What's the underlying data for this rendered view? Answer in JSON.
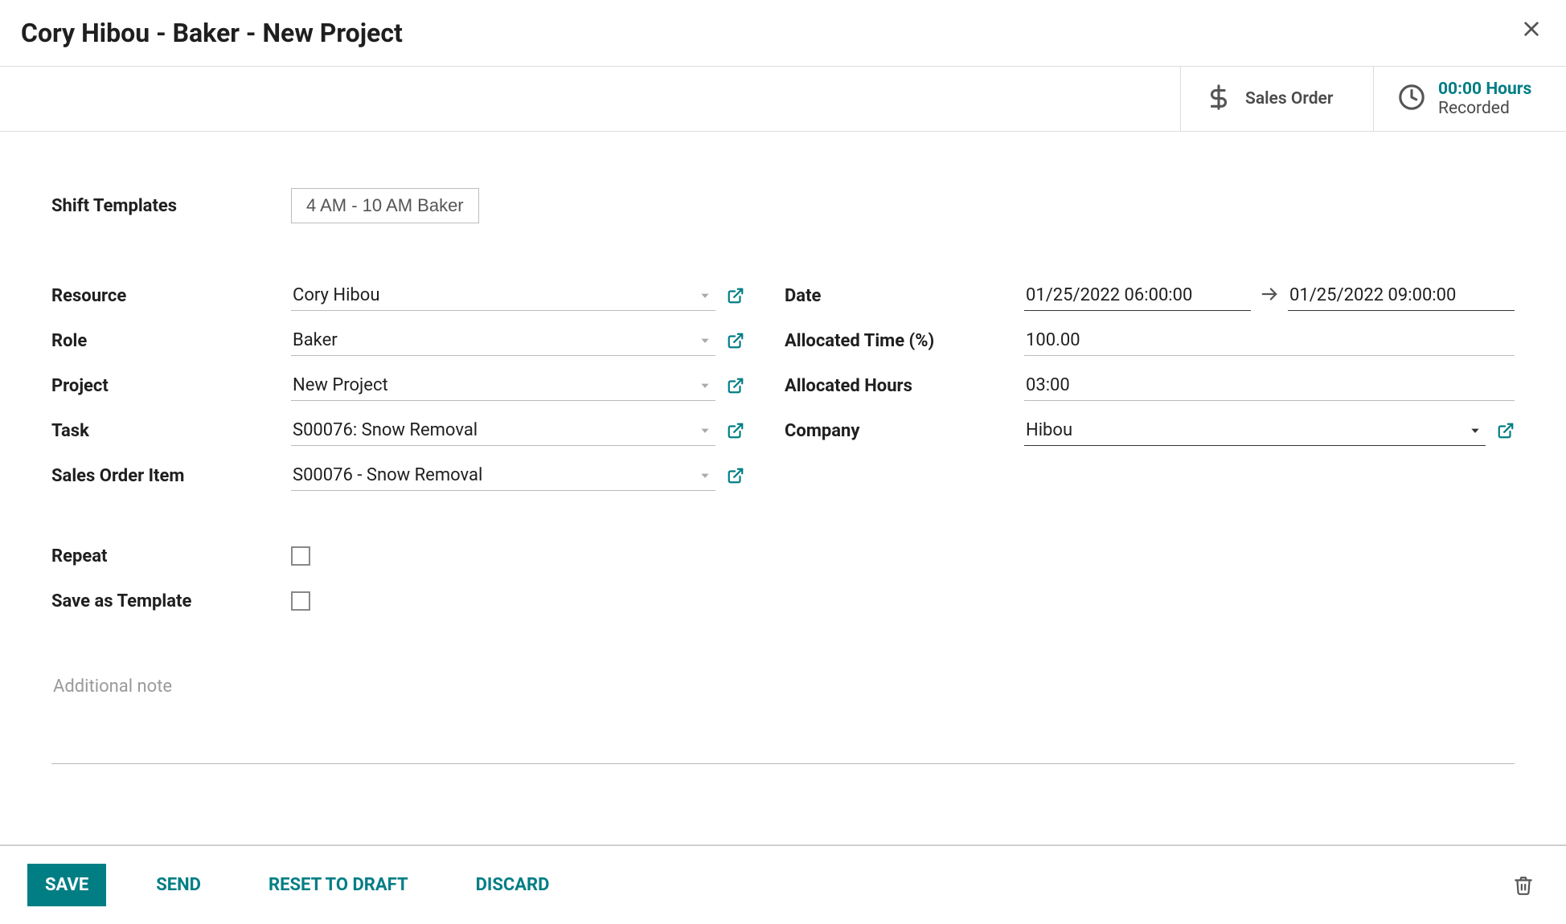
{
  "header": {
    "title": "Cory Hibou - Baker - New Project"
  },
  "stats": {
    "sales_order_label": "Sales Order",
    "hours_top": "00:00 Hours",
    "hours_bot": "Recorded"
  },
  "templates": {
    "label": "Shift Templates",
    "chip": "4 AM - 10 AM Baker"
  },
  "fields": {
    "resource_label": "Resource",
    "resource_value": "Cory Hibou",
    "role_label": "Role",
    "role_value": "Baker",
    "project_label": "Project",
    "project_value": "New Project",
    "task_label": "Task",
    "task_value": "S00076: Snow Removal",
    "soi_label": "Sales Order Item",
    "soi_value": "S00076 - Snow Removal",
    "repeat_label": "Repeat",
    "save_template_label": "Save as Template",
    "date_label": "Date",
    "date_from": "01/25/2022 06:00:00",
    "date_to": "01/25/2022 09:00:00",
    "alloc_pct_label": "Allocated Time (%)",
    "alloc_pct_value": "100.00",
    "alloc_hours_label": "Allocated Hours",
    "alloc_hours_value": "03:00",
    "company_label": "Company",
    "company_value": "Hibou",
    "notes_placeholder": "Additional note"
  },
  "footer": {
    "save": "SAVE",
    "send": "SEND",
    "reset": "RESET TO DRAFT",
    "discard": "DISCARD"
  }
}
